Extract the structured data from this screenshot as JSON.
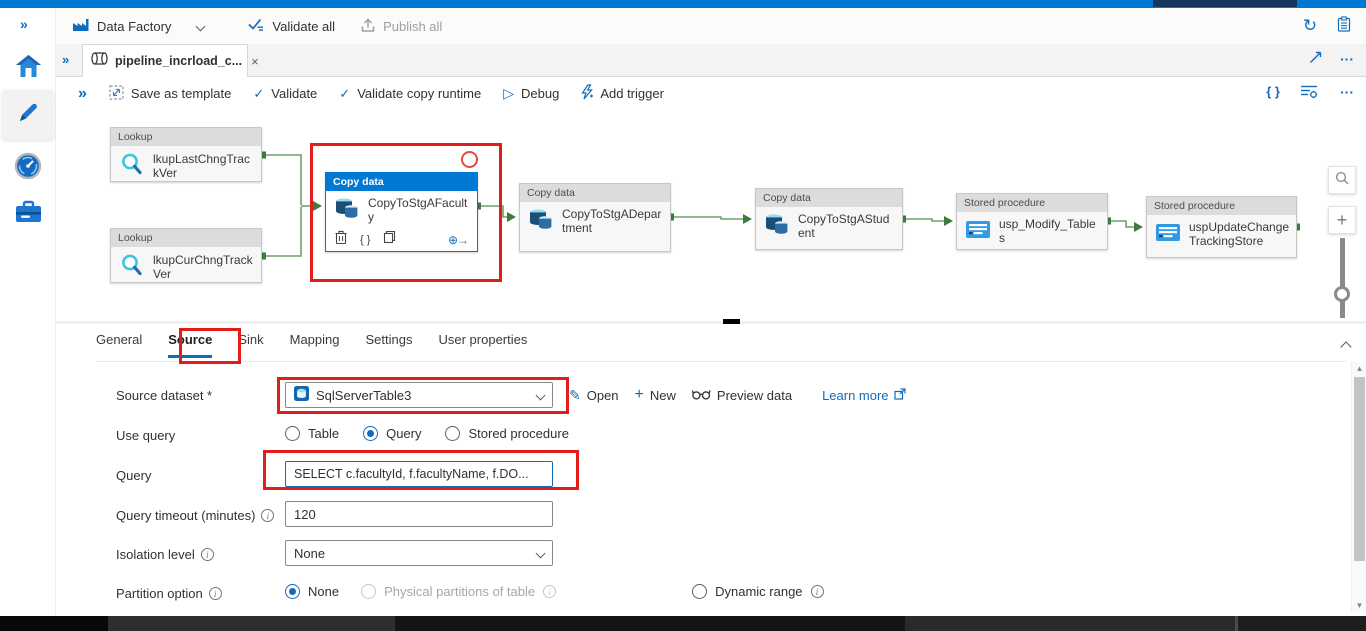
{
  "glyphs": {
    "chevrons": "»",
    "check": "✓",
    "play": "▷",
    "refresh": "↻",
    "close": "×",
    "plus": "+",
    "braces": "{ }",
    "ellipsis": "···",
    "pencil": "✎",
    "add_output": "⊕→",
    "up_arrow": "▲",
    "down_arrow": "▼",
    "info": "i",
    "asterisk": "*"
  },
  "commandbar": {
    "product_label": "Data Factory",
    "validate_all": "Validate all",
    "publish_all": "Publish all"
  },
  "tabbar": {
    "tab_title": "pipeline_incrload_c..."
  },
  "toolbar": {
    "save_as_template": "Save as template",
    "validate": "Validate",
    "validate_copy_runtime": "Validate copy runtime",
    "debug": "Debug",
    "add_trigger": "Add trigger"
  },
  "canvas": {
    "activities": [
      {
        "type": "Lookup",
        "name": "lkupLastChngTrackVer"
      },
      {
        "type": "Lookup",
        "name": "lkupCurChngTrackVer"
      },
      {
        "type": "Copy data",
        "name": "CopyToStgAFaculty",
        "selected": true
      },
      {
        "type": "Copy data",
        "name": "CopyToStgADepartment"
      },
      {
        "type": "Copy data",
        "name": "CopyToStgAStudent"
      },
      {
        "type": "Stored procedure",
        "name": "usp_Modify_Tables"
      },
      {
        "type": "Stored procedure",
        "name": "uspUpdateChangeTrackingStore"
      }
    ]
  },
  "panel": {
    "tabs": [
      "General",
      "Source",
      "Sink",
      "Mapping",
      "Settings",
      "User properties"
    ],
    "active_tab": "Source",
    "rows": {
      "source_dataset": {
        "label": "Source dataset *",
        "value": "SqlServerTable3",
        "open": "Open",
        "new": "New",
        "preview_data": "Preview data",
        "learn_more": "Learn more"
      },
      "use_query": {
        "label": "Use query",
        "table": "Table",
        "query": "Query",
        "stored_procedure": "Stored procedure",
        "selected": "Query"
      },
      "query": {
        "label": "Query",
        "value": "SELECT c.facultyId, f.facultyName, f.DO..."
      },
      "query_timeout": {
        "label": "Query timeout (minutes)",
        "value": "120"
      },
      "isolation_level": {
        "label": "Isolation level",
        "value": "None"
      },
      "partition_option": {
        "label": "Partition option",
        "none": "None",
        "physical": "Physical partitions of table",
        "dynamic": "Dynamic range",
        "selected": "None"
      }
    }
  },
  "colors": {
    "topbar_blue": "#0078d4",
    "accent_blue": "#0f6cbd",
    "annotation_red": "#e21b1b",
    "connector_green": "#6ba26b"
  }
}
